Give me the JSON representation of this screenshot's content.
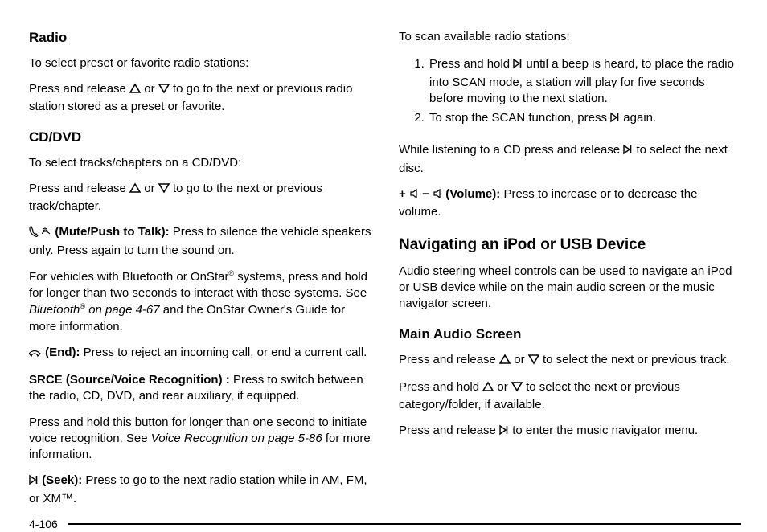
{
  "left": {
    "radioHeading": "Radio",
    "radioIntro": "To select preset or favorite radio stations:",
    "radioPressPre": "Press and release ",
    "orWord": " or ",
    "radioPressPost": " to go to the next or previous radio station stored as a preset or favorite.",
    "cdHeading": "CD/DVD",
    "cdIntro": "To select tracks/chapters on a CD/DVD:",
    "cdPressPre": "Press and release ",
    "cdPressPost": " to go to the next or previous track/chapter.",
    "muteLabel": " (Mute/Push to Talk):",
    "muteText": " Press to silence the vehicle speakers only. Press again to turn the sound on.",
    "btPara1": "For vehicles with Bluetooth or OnStar",
    "btParaSup": "®",
    "btPara2": " systems, press and hold for longer than two seconds to interact with those systems. See ",
    "btLinkPre": "Bluetooth",
    "btLinkSup": "®",
    "btLinkPost": " on page 4-67",
    "btPara3": " and the OnStar Owner's Guide for more information.",
    "endLabel": " (End):",
    "endText": " Press to reject an incoming call, or end a current call.",
    "srceLabel": "SRCE (Source/Voice Recognition)",
    "srceColon": " :",
    "srceText": " Press to switch between the radio, CD, DVD, and rear auxiliary, if equipped.",
    "vrPara1": "Press and hold this button for longer than one second to initiate voice recognition. See ",
    "vrLink": "Voice Recognition on page 5-86",
    "vrPara2": " for more information.",
    "seekLabel": " (Seek):",
    "seekText": " Press to go to the next radio station while in AM, FM, or XM™."
  },
  "right": {
    "scanIntro": "To scan available radio stations:",
    "scanStep1Pre": "Press and hold ",
    "scanStep1Post": " until a beep is heard, to place the radio into SCAN mode, a station will play for five seconds before moving to the next station.",
    "scanStep2Pre": "To stop the SCAN function, press ",
    "scanStep2Post": " again.",
    "cdSelPre": "While listening to a CD press and release ",
    "cdSelPost": " to select the next disc.",
    "volPre": "+ ",
    "volMid": " − ",
    "volLabel": " (Volume):",
    "volText": " Press to increase or to decrease the volume.",
    "navHeading": "Navigating an iPod or USB Device",
    "navIntro": "Audio steering wheel controls can be used to navigate an iPod or USB device while on the main audio screen or the music navigator screen.",
    "mainHeading": "Main Audio Screen",
    "mainP1Pre": "Press and release ",
    "mainP1Post": " to select the next or previous track.",
    "mainP2Pre": "Press and hold ",
    "mainP2Post": " to select the next or previous category/folder, if available.",
    "mainP3Pre": "Press and release ",
    "mainP3Post": " to enter the music navigator menu."
  },
  "pageNumber": "4-106"
}
